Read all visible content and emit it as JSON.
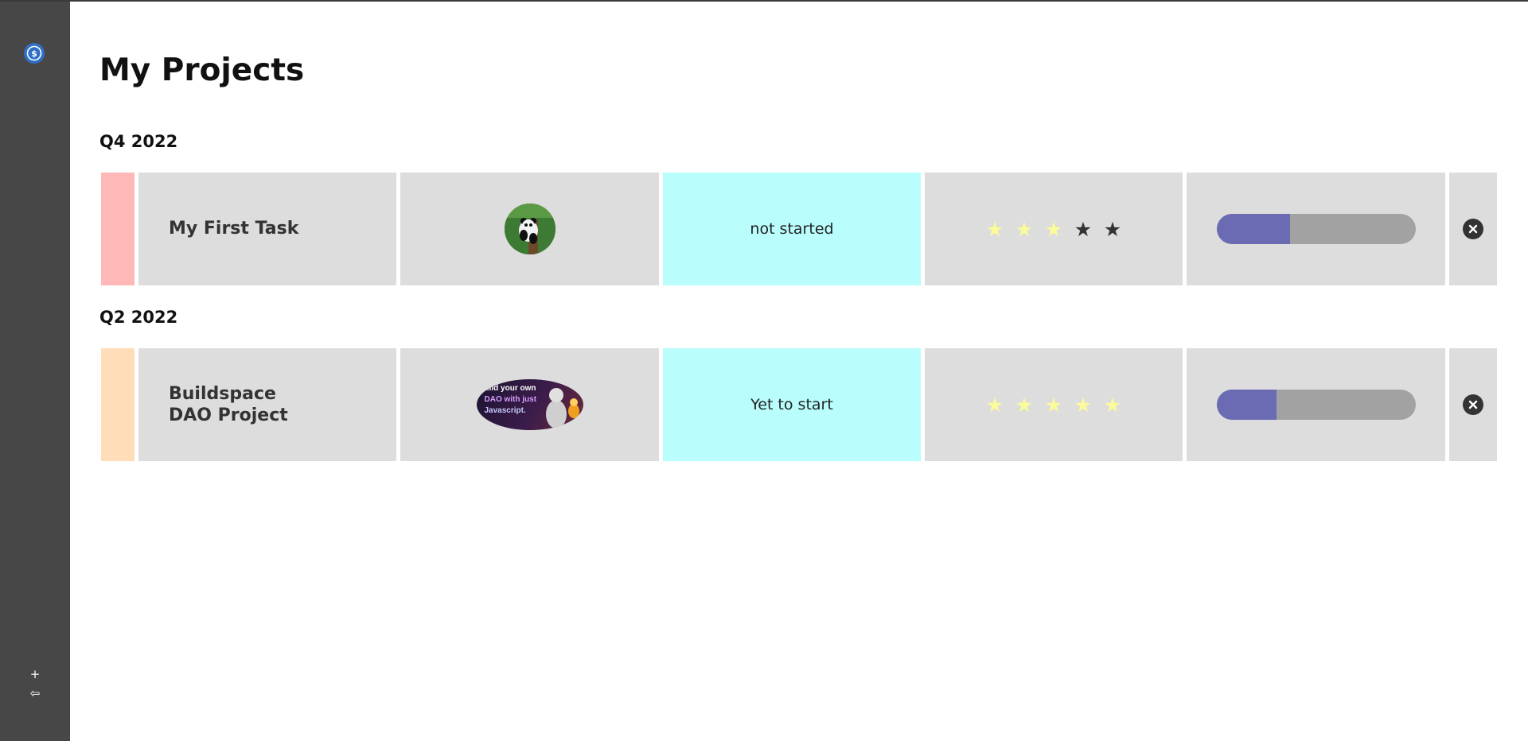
{
  "page": {
    "title": "My Projects"
  },
  "sidebar": {
    "logo_icon": "dollar-circle-icon",
    "add_label": "+",
    "logout_label": "⇦"
  },
  "sections": [
    {
      "title": "Q4 2022",
      "project": {
        "strip_color": "#ffb8b8",
        "name": "My First Task",
        "image": "panda-avatar",
        "status": "not started",
        "status_color": "#b9fdfd",
        "rating": 3,
        "rating_max": 5,
        "progress": 0.37
      }
    },
    {
      "title": "Q2 2022",
      "project": {
        "strip_color": "#ffddb8",
        "name": "Buildspace DAO Project",
        "image": "dao-banner",
        "image_text": [
          "uild your own",
          "DAO with just",
          "Javascript."
        ],
        "status": "Yet to start",
        "status_color": "#b9fdfd",
        "rating": 5,
        "rating_max": 5,
        "progress": 0.3
      }
    }
  ],
  "colors": {
    "sidebar": "#474747",
    "cell": "#dddddd",
    "progress_fill": "#6b6bb3",
    "progress_track": "#a2a2a2",
    "star_on": "#fbfb9a",
    "star_off": "#333333"
  }
}
